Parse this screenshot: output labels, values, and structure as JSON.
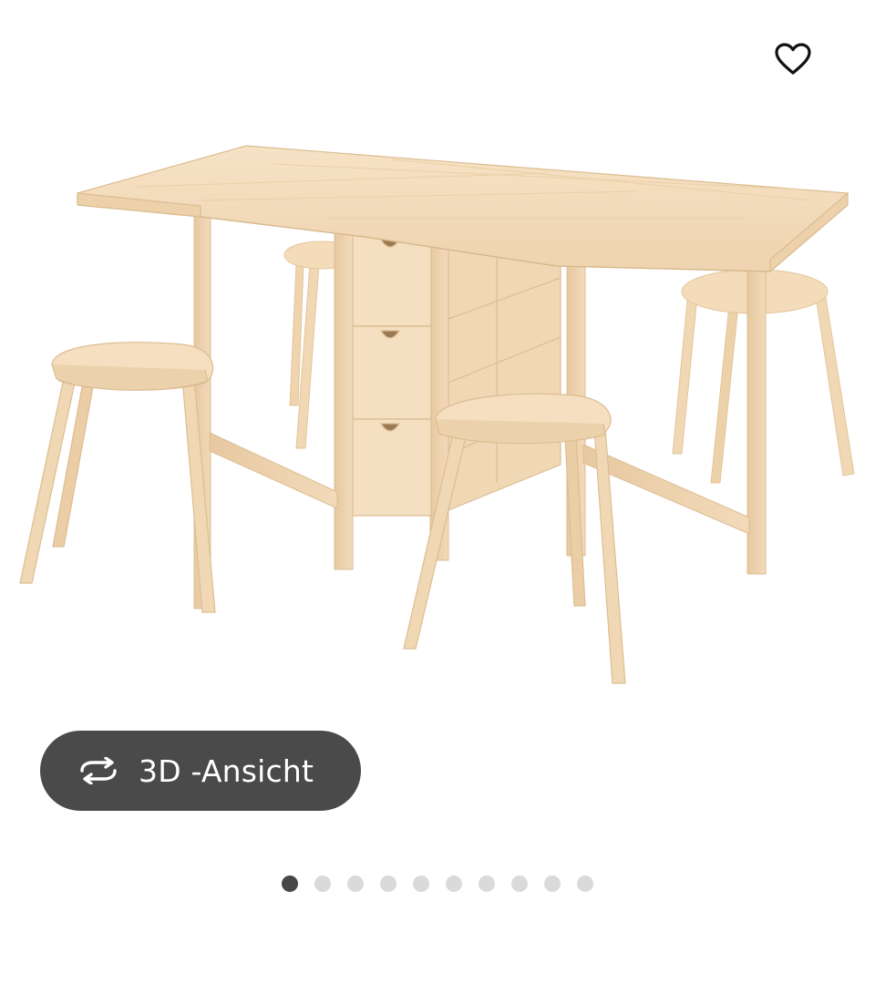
{
  "favorite": {
    "icon": "heart-outline-icon"
  },
  "product_image": {
    "description_icon": "product-photo"
  },
  "view_3d": {
    "label": "3D -Ansicht",
    "icon": "rotate-arrows-icon"
  },
  "carousel": {
    "total": 10,
    "active_index": 0
  },
  "colors": {
    "button_bg": "#4a4a4a",
    "dot_active": "#474747",
    "dot_inactive": "#dadada",
    "wood": "#f3dcbd"
  }
}
